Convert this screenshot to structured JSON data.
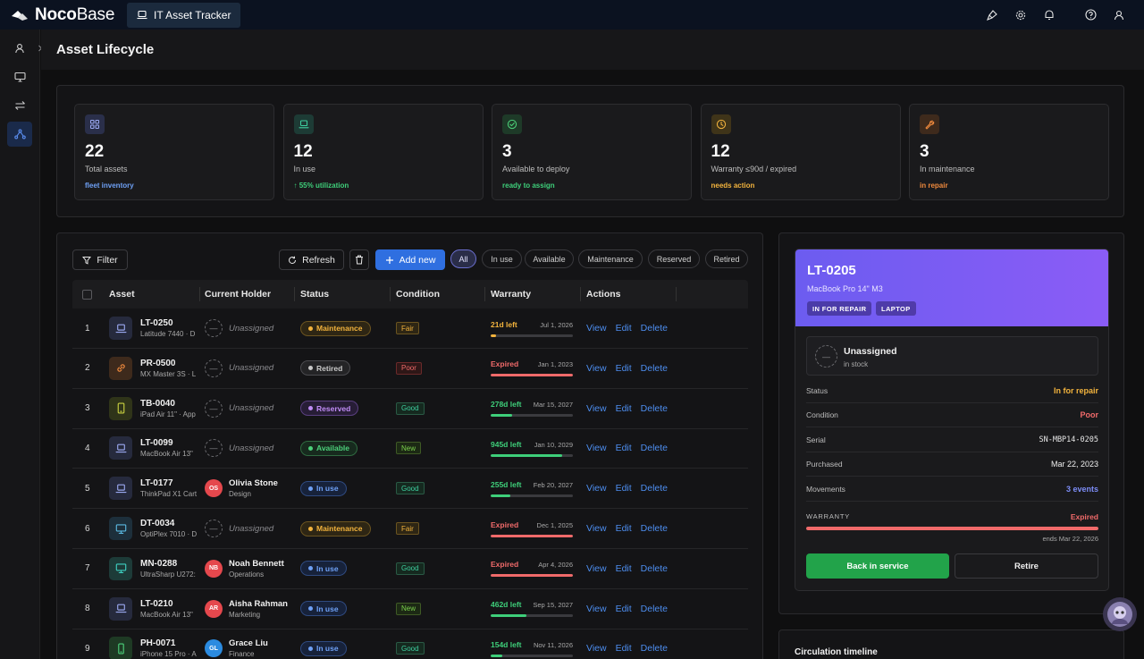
{
  "topbar": {
    "logo_bold": "Noco",
    "logo_thin": "Base",
    "app_tab": "IT Asset Tracker",
    "icons": [
      "brush-icon",
      "gear-icon",
      "bell-icon",
      "help-icon",
      "user-icon"
    ]
  },
  "sidebar": {
    "items": [
      "user-icon",
      "monitor-icon",
      "transfer-icon",
      "network-icon"
    ],
    "active_index": 3
  },
  "header": {
    "title": "Asset Lifecycle"
  },
  "stats": [
    {
      "num": "22",
      "label": "Total assets",
      "sub": "fleet inventory",
      "sub_color": "#6ea0f5",
      "icon": "grid-icon",
      "icon_bg": "#2a2f4a",
      "icon_color": "#9aa8f0"
    },
    {
      "num": "12",
      "label": "In use",
      "sub": "↑ 55% utilization",
      "sub_color": "#3ecf7a",
      "icon": "laptop-icon",
      "icon_bg": "#1d3b35",
      "icon_color": "#3ecfa0"
    },
    {
      "num": "3",
      "label": "Available to deploy",
      "sub": "ready to assign",
      "sub_color": "#3ecf7a",
      "icon": "check-circle-icon",
      "icon_bg": "#1e3a28",
      "icon_color": "#4cd07a"
    },
    {
      "num": "12",
      "label": "Warranty ≤90d / expired",
      "sub": "needs action",
      "sub_color": "#f2b33d",
      "icon": "clock-icon",
      "icon_bg": "#3f3419",
      "icon_color": "#f2b33d"
    },
    {
      "num": "3",
      "label": "In maintenance",
      "sub": "in repair",
      "sub_color": "#f08a3d",
      "icon": "wrench-icon",
      "icon_bg": "#3e2a1c",
      "icon_color": "#f08a3d"
    }
  ],
  "toolbar": {
    "filter": "Filter",
    "refresh": "Refresh",
    "add_new": "Add new",
    "pills": [
      "All",
      "In use",
      "Available",
      "Maintenance",
      "Reserved",
      "Retired"
    ],
    "active_pill": 0
  },
  "table": {
    "headers": [
      "Asset",
      "Current Holder",
      "Status",
      "Condition",
      "Warranty",
      "Actions"
    ],
    "actions": [
      "View",
      "Edit",
      "Delete"
    ],
    "unassigned_label": "Unassigned",
    "rows": [
      {
        "n": "1",
        "code": "LT-0250",
        "desc": "Latitude 7440 · D",
        "icon": "laptop-icon",
        "icon_bg": "#262a3d",
        "icon_color": "#9aa8f0",
        "holder": null,
        "status": "Maintenance",
        "condition": "Fair",
        "w_left": "21d left",
        "w_date": "Jul 1, 2026",
        "w_pct": 0.06,
        "w_kind": "soon"
      },
      {
        "n": "2",
        "code": "PR-0500",
        "desc": "MX Master 3S · L",
        "icon": "link-icon",
        "icon_bg": "#3e2a1c",
        "icon_color": "#f08a3d",
        "holder": null,
        "status": "Retired",
        "condition": "Poor",
        "w_left": "Expired",
        "w_date": "Jan 1, 2023",
        "w_pct": 1,
        "w_kind": "expired"
      },
      {
        "n": "3",
        "code": "TB-0040",
        "desc": "iPad Air 11\" · App",
        "icon": "tablet-icon",
        "icon_bg": "#2f3419",
        "icon_color": "#c8d040",
        "holder": null,
        "status": "Reserved",
        "condition": "Good",
        "w_left": "278d left",
        "w_date": "Mar 15, 2027",
        "w_pct": 0.26,
        "w_kind": "ok"
      },
      {
        "n": "4",
        "code": "LT-0099",
        "desc": "MacBook Air 13\"",
        "icon": "laptop-icon",
        "icon_bg": "#262a3d",
        "icon_color": "#9aa8f0",
        "holder": null,
        "status": "Available",
        "condition": "New",
        "w_left": "945d left",
        "w_date": "Jan 10, 2029",
        "w_pct": 0.87,
        "w_kind": "ok"
      },
      {
        "n": "5",
        "code": "LT-0177",
        "desc": "ThinkPad X1 Cart",
        "icon": "laptop-icon",
        "icon_bg": "#262a3d",
        "icon_color": "#9aa8f0",
        "holder": {
          "initials": "OS",
          "name": "Olivia Stone",
          "dept": "Design",
          "color": "#e5484d"
        },
        "status": "In use",
        "condition": "Good",
        "w_left": "255d left",
        "w_date": "Feb 20, 2027",
        "w_pct": 0.24,
        "w_kind": "ok"
      },
      {
        "n": "6",
        "code": "DT-0034",
        "desc": "OptiPlex 7010 · D",
        "icon": "monitor-icon",
        "icon_bg": "#1d2f3b",
        "icon_color": "#5ab8e0",
        "holder": null,
        "status": "Maintenance",
        "condition": "Fair",
        "w_left": "Expired",
        "w_date": "Dec 1, 2025",
        "w_pct": 1,
        "w_kind": "expired"
      },
      {
        "n": "7",
        "code": "MN-0288",
        "desc": "UltraSharp U272:",
        "icon": "monitor-icon",
        "icon_bg": "#1d3b38",
        "icon_color": "#3ecfc0",
        "holder": {
          "initials": "NB",
          "name": "Noah Bennett",
          "dept": "Operations",
          "color": "#e5484d"
        },
        "status": "In use",
        "condition": "Good",
        "w_left": "Expired",
        "w_date": "Apr 4, 2026",
        "w_pct": 1,
        "w_kind": "expired"
      },
      {
        "n": "8",
        "code": "LT-0210",
        "desc": "MacBook Air 13\"",
        "icon": "laptop-icon",
        "icon_bg": "#262a3d",
        "icon_color": "#9aa8f0",
        "holder": {
          "initials": "AR",
          "name": "Aisha Rahman",
          "dept": "Marketing",
          "color": "#e5484d"
        },
        "status": "In use",
        "condition": "New",
        "w_left": "462d left",
        "w_date": "Sep 15, 2027",
        "w_pct": 0.43,
        "w_kind": "ok"
      },
      {
        "n": "9",
        "code": "PH-0071",
        "desc": "iPhone 15 Pro · A",
        "icon": "phone-icon",
        "icon_bg": "#1e3a24",
        "icon_color": "#4cd07a",
        "holder": {
          "initials": "GL",
          "name": "Grace Liu",
          "dept": "Finance",
          "color": "#2b8be0"
        },
        "status": "In use",
        "condition": "Good",
        "w_left": "154d left",
        "w_date": "Nov 11, 2026",
        "w_pct": 0.14,
        "w_kind": "ok"
      }
    ]
  },
  "status_styles": {
    "Maintenance": {
      "fg": "#f2b33d",
      "bg": "#2e2614",
      "border": "#6b5420"
    },
    "Retired": {
      "fg": "#c8c8c8",
      "bg": "#242426",
      "border": "#4a4a4e"
    },
    "Reserved": {
      "fg": "#c08cf5",
      "bg": "#271d36",
      "border": "#5a3f80"
    },
    "Available": {
      "fg": "#4cd07a",
      "bg": "#172a1e",
      "border": "#2f6a40"
    },
    "In use": {
      "fg": "#6ea0f5",
      "bg": "#17223a",
      "border": "#2f4a80"
    }
  },
  "condition_styles": {
    "Fair": {
      "fg": "#f2b33d",
      "bg": "#2e2614",
      "border": "#6b5420"
    },
    "Poor": {
      "fg": "#f06a6a",
      "bg": "#2e1717",
      "border": "#6b2a2a"
    },
    "Good": {
      "fg": "#3ecfa0",
      "bg": "#15291f",
      "border": "#2a5a45"
    },
    "New": {
      "fg": "#7ad04c",
      "bg": "#1c2914",
      "border": "#3f5a25"
    }
  },
  "warranty_colors": {
    "ok": "#3ecf7a",
    "soon": "#f2b33d",
    "expired": "#f06a6a"
  },
  "detail": {
    "code": "LT-0205",
    "model": "MacBook Pro 14\" M3",
    "tags": [
      "IN FOR REPAIR",
      "LAPTOP"
    ],
    "holder_name": "Unassigned",
    "holder_sub": "in stock",
    "fields": [
      {
        "key": "Status",
        "value": "In for repair",
        "color": "#f2b33d",
        "bold": true,
        "mono": false
      },
      {
        "key": "Condition",
        "value": "Poor",
        "color": "#f06a6a",
        "bold": true,
        "mono": false
      },
      {
        "key": "Serial",
        "value": "SN-MBP14-0205",
        "color": "#e6e6e6",
        "bold": false,
        "mono": true
      },
      {
        "key": "Purchased",
        "value": "Mar 22, 2023",
        "color": "#f0f0f0",
        "bold": false,
        "mono": false
      },
      {
        "key": "Movements",
        "value": "3 events",
        "color": "#7c8cf5",
        "bold": true,
        "mono": false
      }
    ],
    "warranty_label": "WARRANTY",
    "warranty_status": "Expired",
    "warranty_ends": "ends Mar 22, 2026",
    "warranty_pct": 1,
    "btn_back": "Back in service",
    "btn_retire": "Retire"
  },
  "timeline": {
    "title": "Circulation timeline"
  }
}
